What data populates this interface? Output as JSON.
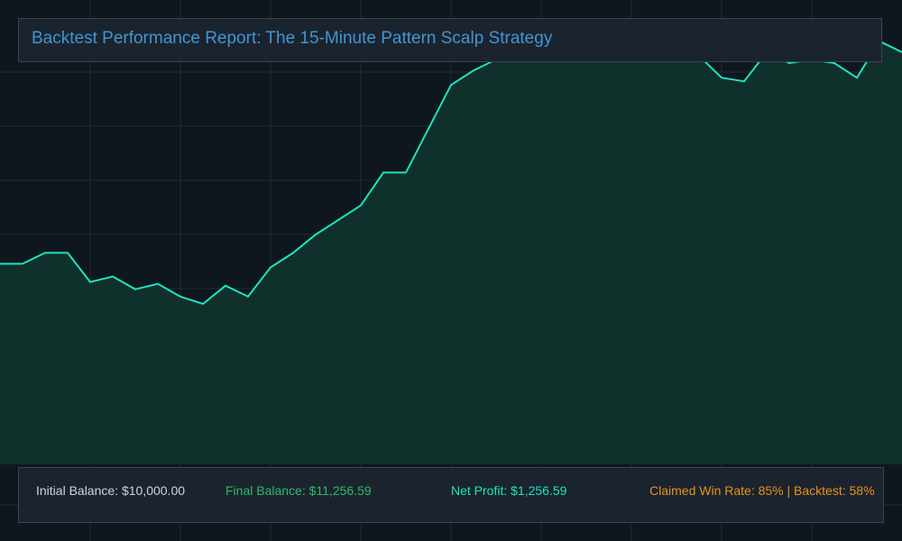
{
  "title": "Backtest Performance Report: The 15-Minute Pattern Scalp Strategy",
  "colors": {
    "background": "#0f171e",
    "panel": "#1b242e",
    "title": "#3f96d5",
    "line": "#1ee3c0",
    "area": "#10302c",
    "grid": "#1e2c33",
    "initial": "#d0d4d8",
    "final": "#2fb96a",
    "profit": "#1ee3c0",
    "claim": "#e8921a"
  },
  "stats": {
    "initial_balance": "Initial Balance: $10,000.00",
    "final_balance": "Final Balance: $11,256.59",
    "net_profit": "Net Profit: $1,256.59",
    "win_rate": "Claimed Win Rate: 85% | Backtest: 58%"
  },
  "chart_data": {
    "type": "area",
    "title": "Backtest Performance Report: The 15-Minute Pattern Scalp Strategy",
    "xlabel": "",
    "ylabel": "",
    "grid": true,
    "x": [
      0,
      1,
      2,
      3,
      4,
      5,
      6,
      7,
      8,
      9,
      10,
      11,
      12,
      13,
      14,
      15,
      16,
      17,
      18,
      19,
      20,
      21,
      22,
      23,
      24,
      25,
      26,
      27,
      28,
      29,
      30,
      31,
      32,
      33,
      34,
      35,
      36,
      37,
      38,
      39,
      40
    ],
    "values": [
      10000,
      10000,
      10030,
      10030,
      9950,
      9965,
      9930,
      9945,
      9910,
      9890,
      9940,
      9910,
      9990,
      10030,
      10080,
      10120,
      10160,
      10250,
      10250,
      10370,
      10490,
      10530,
      10560,
      10640,
      10640,
      10610,
      10620,
      10670,
      10620,
      10610,
      10600,
      10570,
      10510,
      10500,
      10580,
      10550,
      10560,
      10550,
      10510,
      10610,
      10580
    ],
    "ylim": [
      9450,
      10550
    ],
    "series": [
      {
        "values": [
          10000,
          10000,
          10030,
          10030,
          9950,
          9965,
          9930,
          9945,
          9910,
          9890,
          9940,
          9910,
          9990,
          10030,
          10080,
          10120,
          10160,
          10250,
          10250,
          10370,
          10490,
          10530,
          10560,
          10640,
          10640,
          10610,
          10620,
          10670,
          10620,
          10610,
          10600,
          10570,
          10510,
          10500,
          10580,
          10550,
          10560,
          10550,
          10510,
          10610,
          10580
        ]
      }
    ]
  }
}
